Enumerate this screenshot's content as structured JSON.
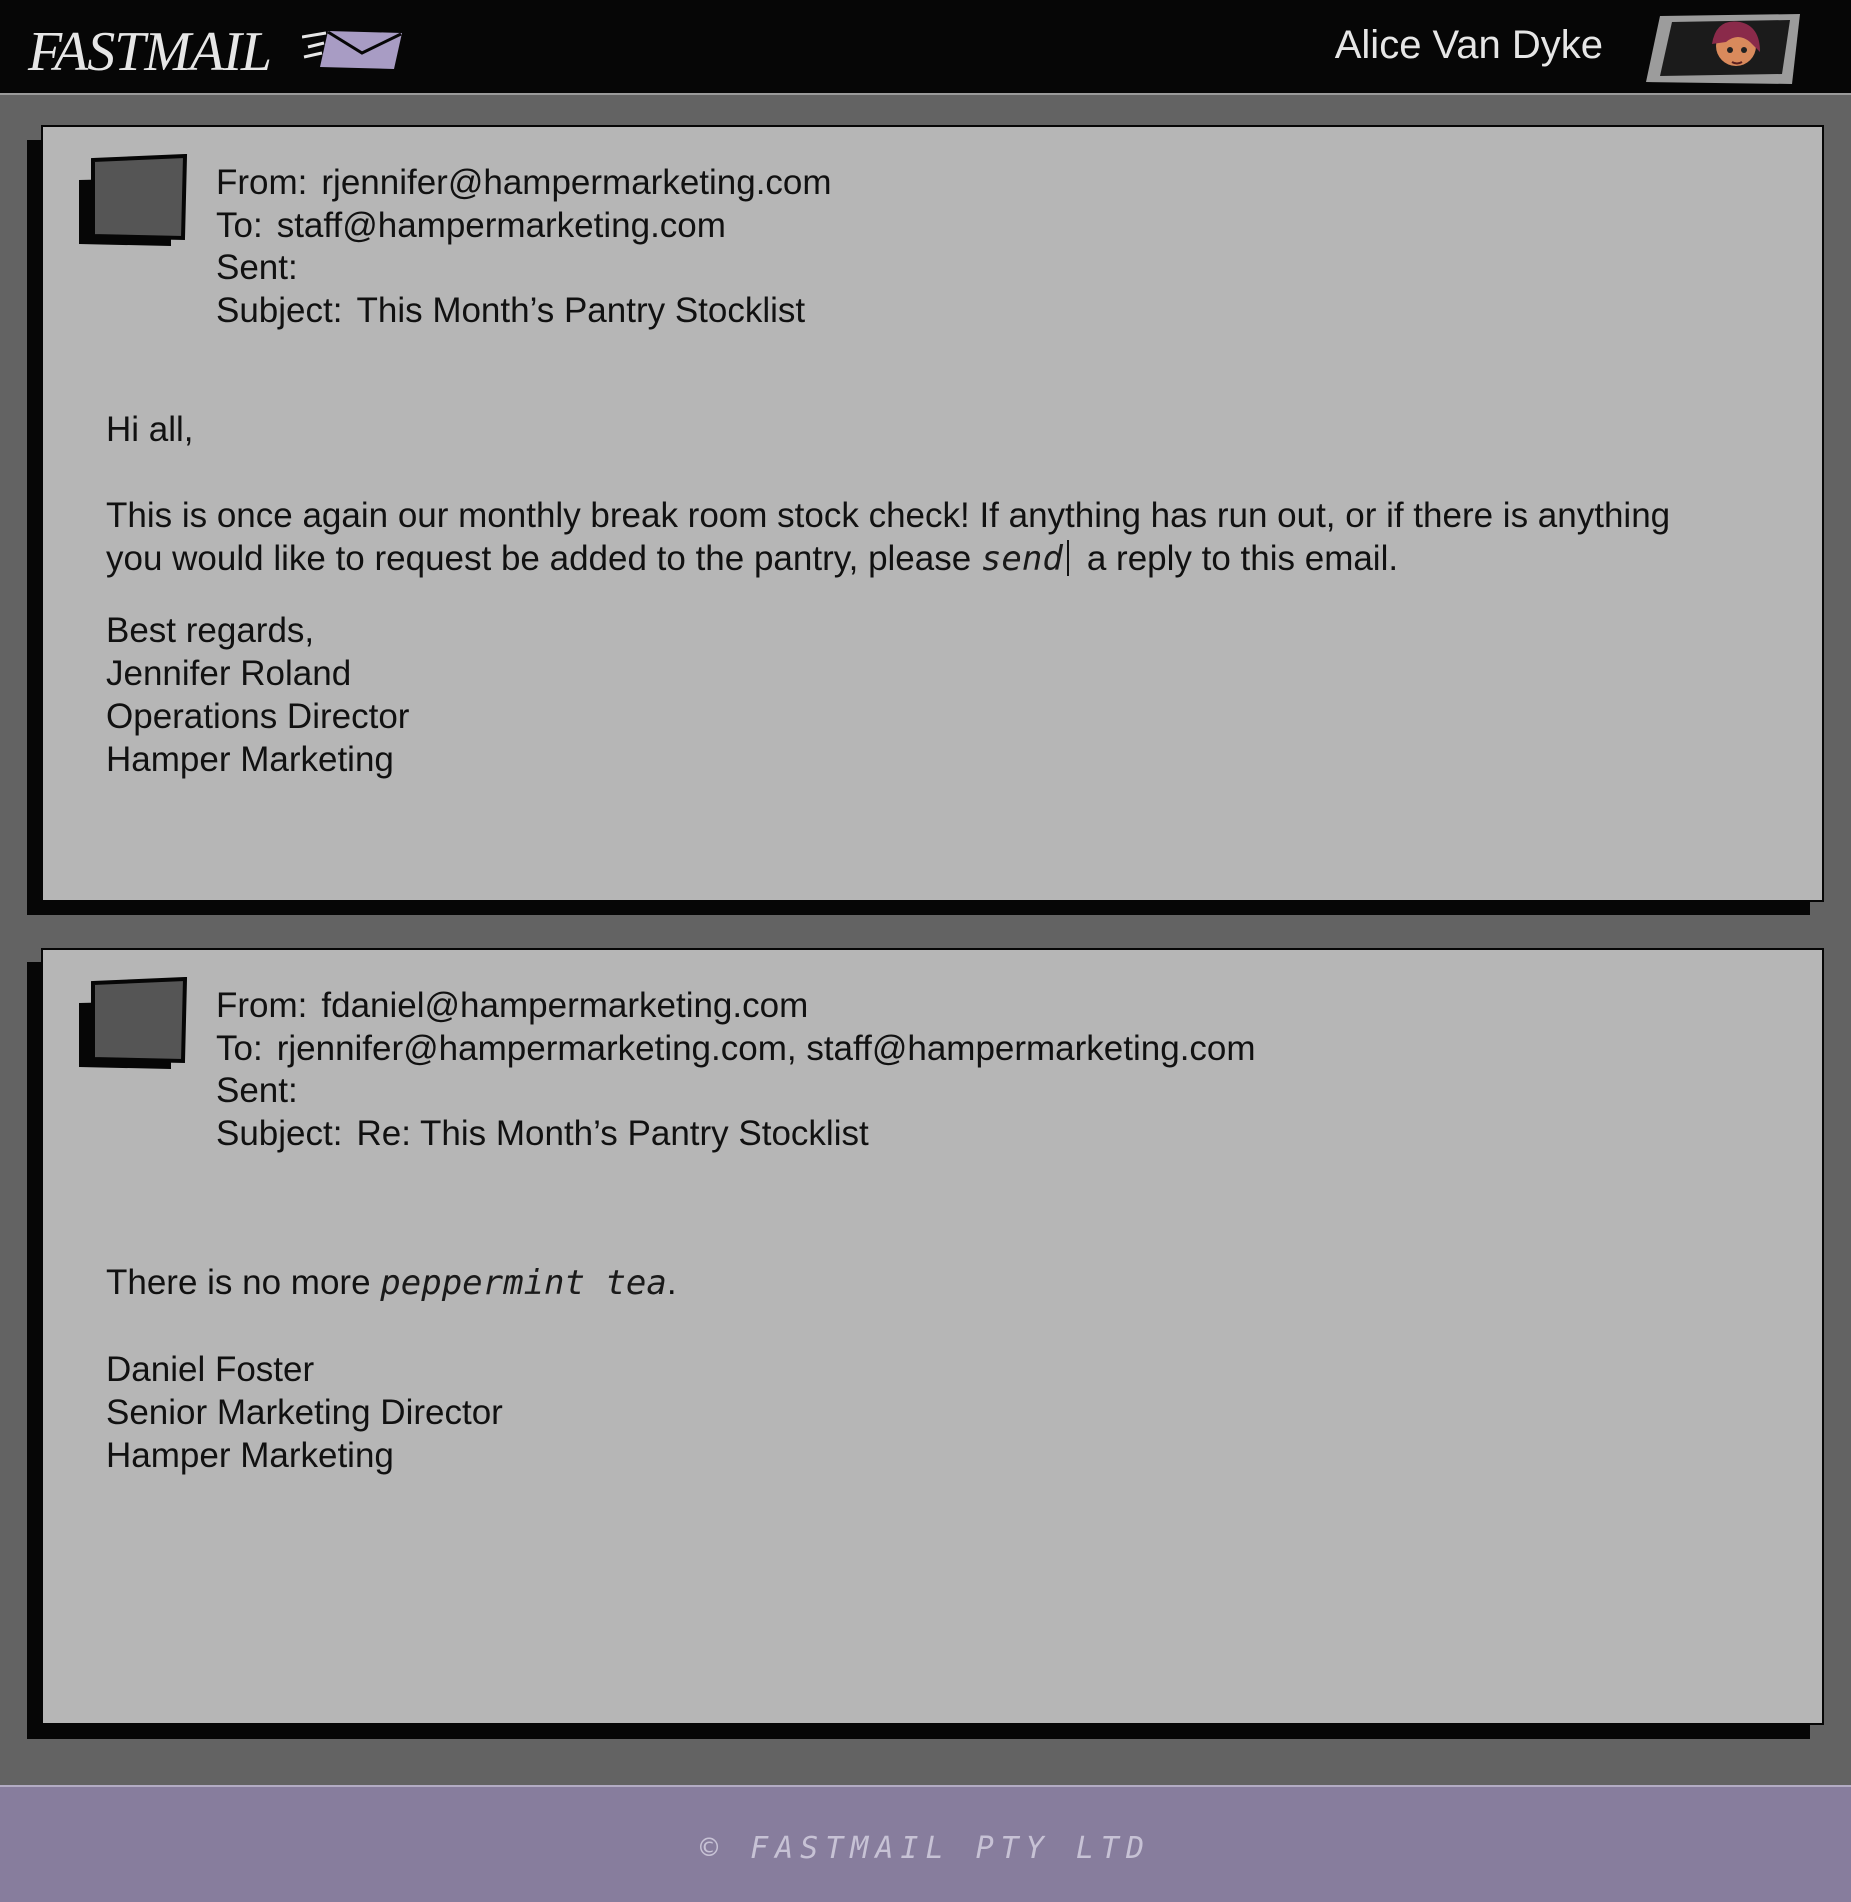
{
  "header": {
    "logo_text": "FASTMAIL",
    "user_name": "Alice Van Dyke",
    "brand_color": "#877d9d"
  },
  "emails": [
    {
      "from_label": "From:",
      "from": "rjennifer@hampermarketing.com",
      "to_label": "To:",
      "to": "staff@hampermarketing.com",
      "sent_label": "Sent:",
      "sent": "",
      "subject_label": "Subject:",
      "subject": "This Month’s Pantry Stocklist",
      "greeting": "Hi all,",
      "paragraph_line1": "This is once again our monthly break room stock check! If anything has run out, or if there is anything",
      "paragraph_line2_pre": "you would like to request be added to the pantry, please",
      "paragraph_line2_hand": "send",
      "paragraph_line2_post": "a reply to this email.",
      "signoff": "Best regards,",
      "signature": [
        "Jennifer Roland",
        "Operations Director",
        "Hamper Marketing"
      ]
    },
    {
      "from_label": "From:",
      "from": "fdaniel@hampermarketing.com",
      "to_label": "To:",
      "to": "rjennifer@hampermarketing.com, staff@hampermarketing.com",
      "sent_label": "Sent:",
      "sent": "",
      "subject_label": "Subject:",
      "subject": "Re: This Month’s Pantry Stocklist",
      "line_pre": "There is no more",
      "line_hand": "peppermint tea",
      "line_post": ".",
      "signature": [
        "Daniel Foster",
        "Senior Marketing Director",
        "Hamper Marketing"
      ]
    }
  ],
  "footer": {
    "copyright_symbol": "©",
    "text": "FASTMAIL PTY LTD"
  }
}
